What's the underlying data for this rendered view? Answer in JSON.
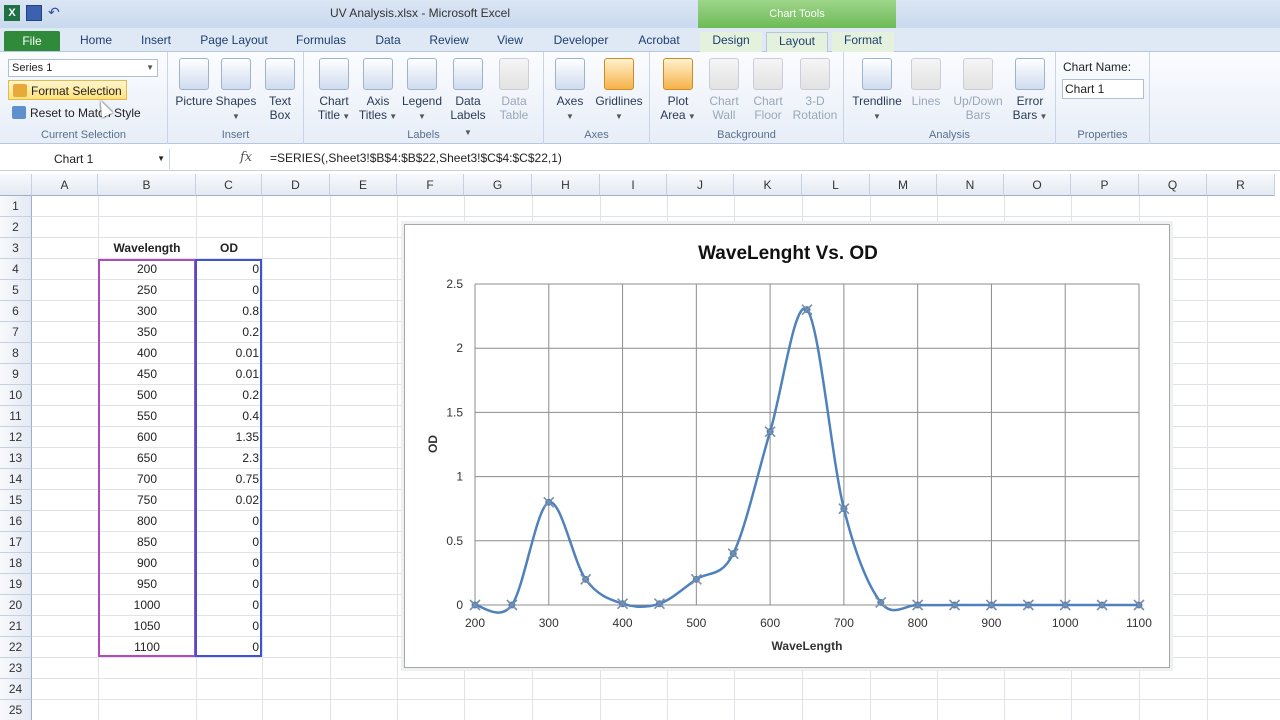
{
  "window": {
    "title": "UV Analysis.xlsx  -  Microsoft Excel",
    "context_tools": "Chart Tools"
  },
  "tabs": [
    "File",
    "Home",
    "Insert",
    "Page Layout",
    "Formulas",
    "Data",
    "Review",
    "View",
    "Developer",
    "Acrobat",
    "Design",
    "Layout",
    "Format"
  ],
  "active_tab": "Layout",
  "ribbon": {
    "current_selection": {
      "series_value": "Series 1",
      "format_selection": "Format Selection",
      "reset_to_match_style": "Reset to Match Style",
      "label": "Current Selection"
    },
    "insert": {
      "label": "Insert",
      "picture": "Picture",
      "shapes": "Shapes",
      "text_box": [
        "Text",
        "Box"
      ]
    },
    "labels": {
      "label": "Labels",
      "chart_title": [
        "Chart",
        "Title"
      ],
      "axis_titles": [
        "Axis",
        "Titles"
      ],
      "legend": "Legend",
      "data_labels": [
        "Data",
        "Labels"
      ],
      "data_table": [
        "Data",
        "Table"
      ]
    },
    "axes": {
      "label": "Axes",
      "axes": "Axes",
      "gridlines": "Gridlines"
    },
    "background": {
      "label": "Background",
      "plot_area": [
        "Plot",
        "Area"
      ],
      "chart_wall": [
        "Chart",
        "Wall"
      ],
      "chart_floor": [
        "Chart",
        "Floor"
      ],
      "rotation": [
        "3-D",
        "Rotation"
      ]
    },
    "analysis": {
      "label": "Analysis",
      "trendline": "Trendline",
      "lines": "Lines",
      "up_down_bars": [
        "Up/Down",
        "Bars"
      ],
      "error_bars": [
        "Error",
        "Bars"
      ]
    },
    "properties": {
      "label": "Properties",
      "chart_name_label": "Chart Name:",
      "chart_name_value": "Chart 1"
    }
  },
  "formula_bar": {
    "name_box": "Chart 1",
    "fx": "fx",
    "formula": "=SERIES(,Sheet3!$B$4:$B$22,Sheet3!$C$4:$C$22,1)"
  },
  "columns": [
    "A",
    "B",
    "C",
    "D",
    "E",
    "F",
    "G",
    "H",
    "I",
    "J",
    "K",
    "L",
    "M",
    "N",
    "O",
    "P",
    "Q",
    "R"
  ],
  "rows": [
    "1",
    "2",
    "3",
    "4",
    "5",
    "6",
    "7",
    "8",
    "9",
    "10",
    "11",
    "12",
    "13",
    "14",
    "15",
    "16",
    "17",
    "18",
    "19",
    "20",
    "21",
    "22",
    "23",
    "24",
    "25"
  ],
  "table": {
    "header_wavelength": "Wavelength",
    "header_od": "OD",
    "wavelength": [
      "200",
      "250",
      "300",
      "350",
      "400",
      "450",
      "500",
      "550",
      "600",
      "650",
      "700",
      "750",
      "800",
      "850",
      "900",
      "950",
      "1000",
      "1050",
      "1100"
    ],
    "od": [
      "0",
      "0",
      "0.8",
      "0.2",
      "0.01",
      "0.01",
      "0.2",
      "0.4",
      "1.35",
      "2.3",
      "0.75",
      "0.02",
      "0",
      "0",
      "0",
      "0",
      "0",
      "0",
      "0"
    ]
  },
  "colors": {
    "series": "#4f81bd",
    "range_x": "#b04bb8",
    "range_y": "#3f52d6",
    "file_tab": "#2f8a3a"
  },
  "chart_data": {
    "type": "line",
    "title": "WaveLenght Vs. OD",
    "xlabel": "WaveLength",
    "ylabel": "OD",
    "x": [
      200,
      250,
      300,
      350,
      400,
      450,
      500,
      550,
      600,
      650,
      700,
      750,
      800,
      850,
      900,
      950,
      1000,
      1050,
      1100
    ],
    "series": [
      {
        "values": [
          0,
          0,
          0.8,
          0.2,
          0.01,
          0.01,
          0.2,
          0.4,
          1.35,
          2.3,
          0.75,
          0.02,
          0,
          0,
          0,
          0,
          0,
          0,
          0
        ]
      }
    ],
    "xlim": [
      200,
      1100
    ],
    "ylim": [
      0,
      2.5
    ],
    "x_ticks": [
      "200",
      "300",
      "400",
      "500",
      "600",
      "700",
      "800",
      "900",
      "1000",
      "1100"
    ],
    "y_ticks": [
      "0",
      "0.5",
      "1",
      "1.5",
      "2",
      "2.5"
    ],
    "smoothed": true,
    "selected": true,
    "grid": true,
    "legend": "none"
  }
}
